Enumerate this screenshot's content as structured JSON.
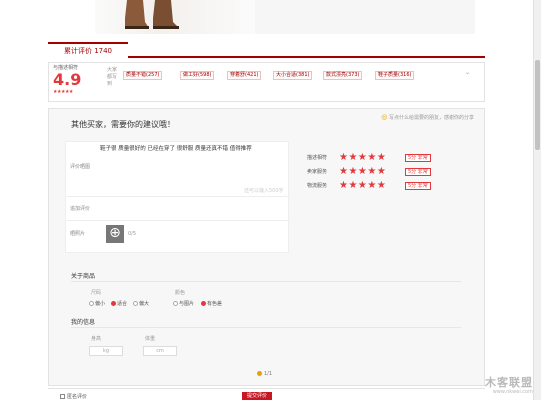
{
  "tab": {
    "label": "累计评价 1740"
  },
  "summary": {
    "score_label": "与描述相符",
    "score_value": "4.9",
    "score_stars": "★★★★★",
    "impression_label": "大家都写到",
    "tags": [
      "质量不错(257)",
      "做工好(598)",
      "穿着舒(421)",
      "大小合适(381)",
      "款式漂亮(373)",
      "鞋子质量(316)"
    ]
  },
  "form": {
    "title": "其他买家，需要你的建议哦！",
    "hint": "写点什么给需要的朋友，感谢你的分享",
    "label_review": "评价晒图",
    "review_text": "鞋子很 质量很好的 已经在穿了 很舒服 质量还真不错 值得推荐",
    "word_count": "还可以输入500字",
    "label_reply": "追加评价",
    "label_photo": "晒照片",
    "img_count": "0/5",
    "ratings": [
      {
        "label": "描述相符",
        "stars": "★★★★★",
        "score": "5分 非常"
      },
      {
        "label": "卖家服务",
        "stars": "★★★★★",
        "score": "5分 非常"
      },
      {
        "label": "物流服务",
        "stars": "★★★★★",
        "score": "5分 非常"
      }
    ],
    "about_title": "关于商品",
    "size_label": "尺码",
    "size_options": [
      "偏小",
      "适合",
      "偏大"
    ],
    "color_label": "颜色",
    "color_options": [
      "与图片",
      "有色差"
    ],
    "my_info_title": "我的信息",
    "height_label": "身高",
    "weight_label": "体重",
    "height_unit": "cm",
    "weight_unit": "kg",
    "pager_text": "1/1"
  },
  "bottom": {
    "anonymous_label": "匿名评价",
    "submit_label": "提交评价"
  },
  "watermark": {
    "main": "木客联盟",
    "sub": "www.nkwei.com"
  }
}
